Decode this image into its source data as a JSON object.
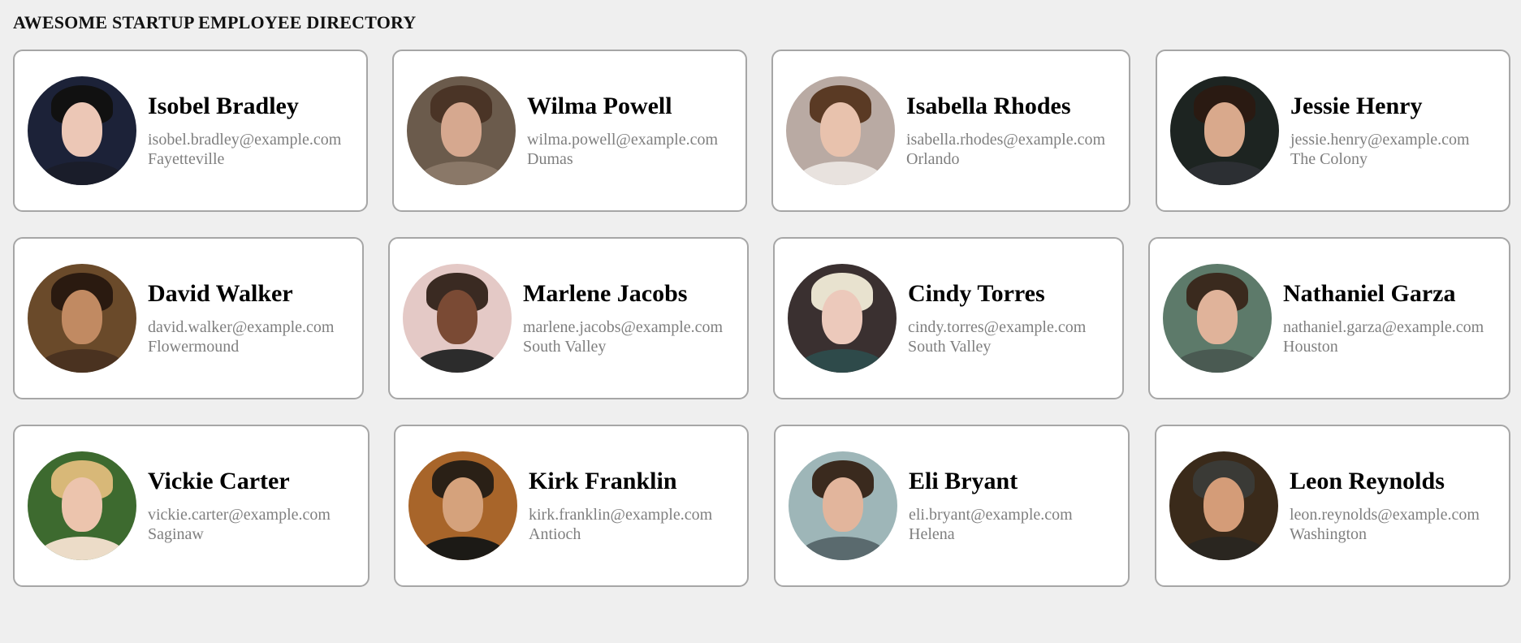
{
  "page": {
    "title": "AWESOME STARTUP EMPLOYEE DIRECTORY"
  },
  "employees": [
    {
      "name": "Isobel Bradley",
      "email": "isobel.bradley@example.com",
      "city": "Fayetteville",
      "avatar_colors": {
        "bg": "#1c2238",
        "skin": "#ecc7b6",
        "hair": "#111111",
        "shirt": "#1a1d2a"
      }
    },
    {
      "name": "Wilma Powell",
      "email": "wilma.powell@example.com",
      "city": "Dumas",
      "avatar_colors": {
        "bg": "#6b5b4c",
        "skin": "#d6a88f",
        "hair": "#4a3426",
        "shirt": "#8a7868"
      }
    },
    {
      "name": "Isabella Rhodes",
      "email": "isabella.rhodes@example.com",
      "city": "Orlando",
      "avatar_colors": {
        "bg": "#b9aaa3",
        "skin": "#e8c2ad",
        "hair": "#5a3a24",
        "shirt": "#e8e2de"
      }
    },
    {
      "name": "Jessie Henry",
      "email": "jessie.henry@example.com",
      "city": "The Colony",
      "avatar_colors": {
        "bg": "#1d2421",
        "skin": "#d9a98c",
        "hair": "#2a1a12",
        "shirt": "#2c2f33"
      }
    },
    {
      "name": "David Walker",
      "email": "david.walker@example.com",
      "city": "Flowermound",
      "avatar_colors": {
        "bg": "#6a4a2a",
        "skin": "#c18a62",
        "hair": "#2a1a10",
        "shirt": "#4a3220"
      }
    },
    {
      "name": "Marlene Jacobs",
      "email": "marlene.jacobs@example.com",
      "city": "South Valley",
      "avatar_colors": {
        "bg": "#e4c9c6",
        "skin": "#7a4a34",
        "hair": "#3a2a22",
        "shirt": "#2c2c2c"
      }
    },
    {
      "name": "Cindy Torres",
      "email": "cindy.torres@example.com",
      "city": "South Valley",
      "avatar_colors": {
        "bg": "#3a3030",
        "skin": "#ecc9bb",
        "hair": "#e8e2cf",
        "shirt": "#2e4a4a"
      }
    },
    {
      "name": "Nathaniel Garza",
      "email": "nathaniel.garza@example.com",
      "city": "Houston",
      "avatar_colors": {
        "bg": "#5d7a6a",
        "skin": "#e0b39a",
        "hair": "#3a2a1e",
        "shirt": "#4a5a52"
      }
    },
    {
      "name": "Vickie Carter",
      "email": "vickie.carter@example.com",
      "city": "Saginaw",
      "avatar_colors": {
        "bg": "#3d6a2f",
        "skin": "#ecc4ad",
        "hair": "#d8b878",
        "shirt": "#ecdcc8"
      }
    },
    {
      "name": "Kirk Franklin",
      "email": "kirk.franklin@example.com",
      "city": "Antioch",
      "avatar_colors": {
        "bg": "#a8652a",
        "skin": "#d5a27c",
        "hair": "#2a2016",
        "shirt": "#1c1a16"
      }
    },
    {
      "name": "Eli Bryant",
      "email": "eli.bryant@example.com",
      "city": "Helena",
      "avatar_colors": {
        "bg": "#9eb6b8",
        "skin": "#e2b59c",
        "hair": "#3a2a1e",
        "shirt": "#5a6a6e"
      }
    },
    {
      "name": "Leon Reynolds",
      "email": "leon.reynolds@example.com",
      "city": "Washington",
      "avatar_colors": {
        "bg": "#3a2a1a",
        "skin": "#d49c78",
        "hair": "#3a3a36",
        "shirt": "#2a2620"
      }
    }
  ]
}
